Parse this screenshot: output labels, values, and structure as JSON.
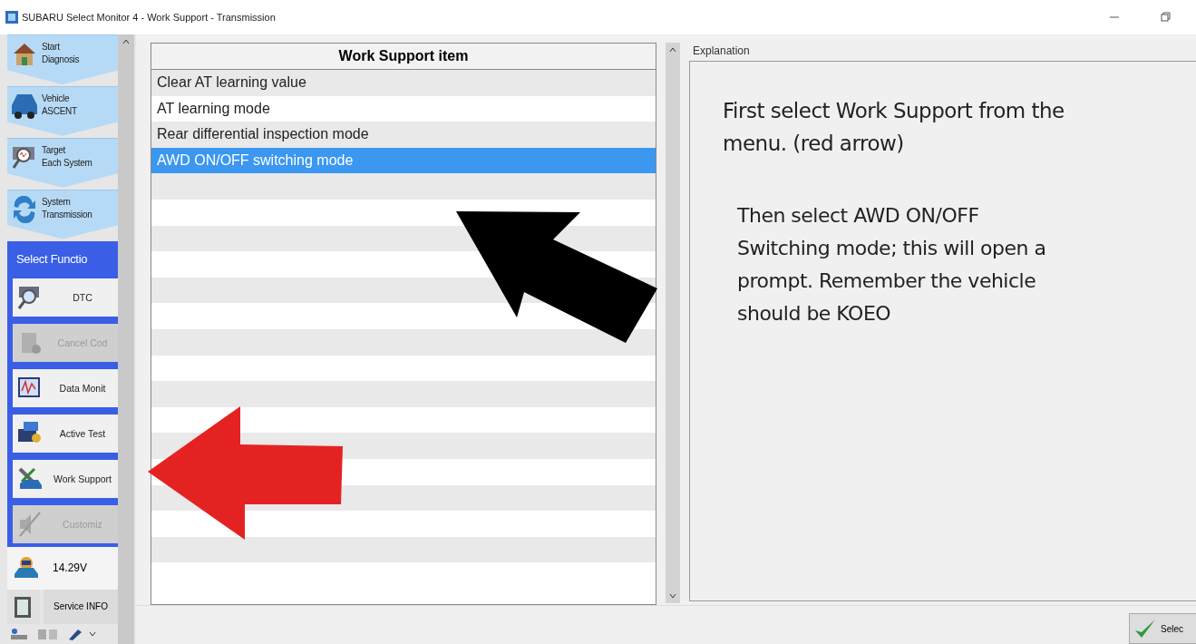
{
  "window": {
    "title": "SUBARU Select Monitor 4 - Work Support - Transmission"
  },
  "sidebar": {
    "steps": [
      {
        "lines": [
          "Start",
          "Diagnosis"
        ]
      },
      {
        "lines": [
          "Vehicle",
          "ASCENT"
        ]
      },
      {
        "lines": [
          "Target",
          "Each System"
        ]
      },
      {
        "lines": [
          "System",
          "Transmission"
        ]
      }
    ],
    "section_title": "Select Functio",
    "functions": [
      {
        "label": "DTC",
        "disabled": false
      },
      {
        "label": "Cancel Cod",
        "disabled": true
      },
      {
        "label": "Data Monit",
        "disabled": false
      },
      {
        "label": "Active Test",
        "disabled": false
      },
      {
        "label": "Work Support",
        "disabled": false
      },
      {
        "label": "Customiz",
        "disabled": true
      }
    ],
    "voltage": "14.29V",
    "service_info": "Service INFO"
  },
  "list": {
    "column": "Work Support item",
    "rows": [
      {
        "label": "Clear AT learning value",
        "selected": false
      },
      {
        "label": "AT learning mode",
        "selected": false
      },
      {
        "label": "Rear differential inspection mode",
        "selected": false
      },
      {
        "label": "AWD ON/OFF switching mode",
        "selected": true
      }
    ]
  },
  "explanation": {
    "title": "Explanation",
    "paragraphs": [
      "First select Work Support from the menu. (red arrow)",
      "Then select AWD ON/OFF Switching mode; this will open a prompt. Remember the vehicle should be KOEO"
    ]
  },
  "footer": {
    "select_button": "Selec"
  }
}
